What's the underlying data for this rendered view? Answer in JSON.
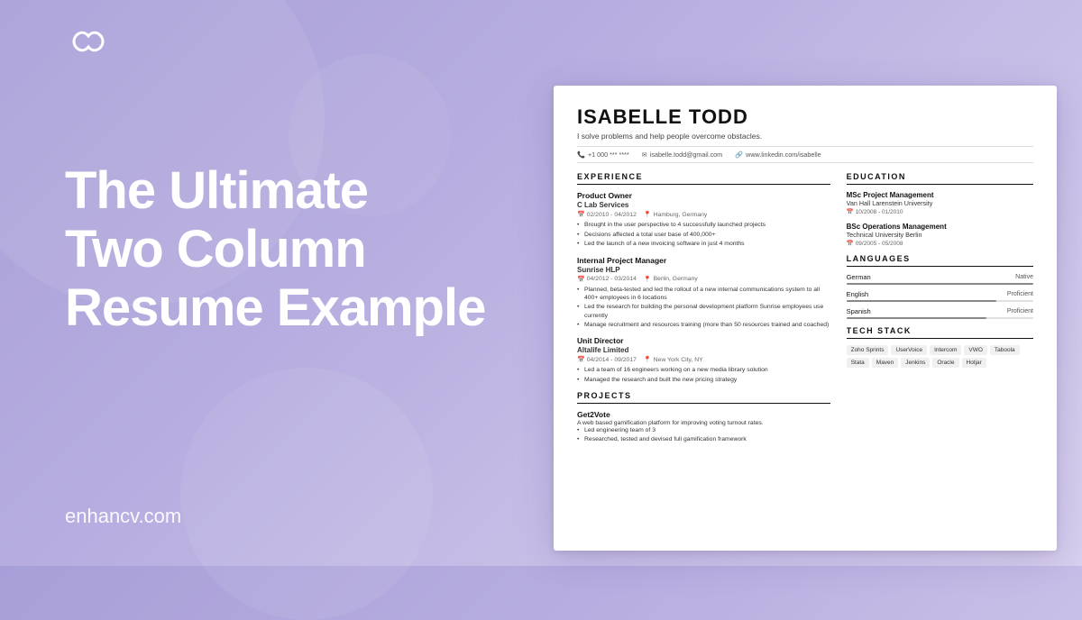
{
  "background": {
    "color_start": "#a89fd8",
    "color_end": "#d8d0ee"
  },
  "logo": {
    "alt": "Enhancv logo infinity"
  },
  "left": {
    "headline_line1": "The Ultimate",
    "headline_line2": "Two Column",
    "headline_line3": "Resume Example",
    "website": "enhancv.com"
  },
  "resume": {
    "name": "ISABELLE TODD",
    "tagline": "I solve problems and help people overcome obstacles.",
    "contact": {
      "phone": "+1 000 *** ****",
      "email": "isabelle.todd@gmail.com",
      "linkedin": "www.linkedin.com/isabelle"
    },
    "experience": {
      "section_title": "EXPERIENCE",
      "jobs": [
        {
          "title": "Product Owner",
          "company": "C Lab Services",
          "date": "02/2010 - 04/2012",
          "location": "Hamburg, Germany",
          "bullets": [
            "Brought in the user perspective to 4 successfully launched projects",
            "Decisions affected a total user base of 400,000+",
            "Led the launch of a new invoicing software in just 4 months"
          ]
        },
        {
          "title": "Internal Project Manager",
          "company": "Sunrise HLP",
          "date": "04/2012 - 03/2014",
          "location": "Berlin, Germany",
          "bullets": [
            "Planned, beta-tested and led the rollout of a new internal communications system to all 400+ employees in 6 locations",
            "Led the research for building the personal development platform Sunrise employees use currently",
            "Manage recruitment and resources training (more than 50 resources trained and coached)"
          ]
        },
        {
          "title": "Unit Director",
          "company": "Altalife Limited",
          "date": "04/2014 - 09/2017",
          "location": "New York City, NY",
          "bullets": [
            "Led a team of 16 engineers working on a new media library solution",
            "Managed the research and built the new pricing strategy"
          ]
        }
      ]
    },
    "projects": {
      "section_title": "PROJECTS",
      "items": [
        {
          "title": "Get2Vote",
          "description": "A web based gamification platform for improving voting turnout rates.",
          "bullets": [
            "Led engineering team of 3",
            "Researched, tested and devised full gamification framework"
          ]
        }
      ]
    },
    "education": {
      "section_title": "EDUCATION",
      "items": [
        {
          "degree": "MSc Project Management",
          "school": "Van Hall Larenstein University",
          "date": "10/2008 - 01/2010"
        },
        {
          "degree": "BSc Operations Management",
          "school": "Technical University Berlin",
          "date": "09/2005 - 05/2008"
        }
      ]
    },
    "languages": {
      "section_title": "LANGUAGES",
      "items": [
        {
          "name": "German",
          "level": "Native",
          "fill_pct": 100
        },
        {
          "name": "English",
          "level": "Proficient",
          "fill_pct": 80
        },
        {
          "name": "Spanish",
          "level": "Proficient",
          "fill_pct": 75
        }
      ]
    },
    "tech_stack": {
      "section_title": "TECH STACK",
      "tags": [
        "Zoho Sprints",
        "UserVoice",
        "Intercom",
        "VWO",
        "Taboola",
        "Stata",
        "Maven",
        "Jenkins",
        "Oracle",
        "Hotjar"
      ]
    }
  }
}
